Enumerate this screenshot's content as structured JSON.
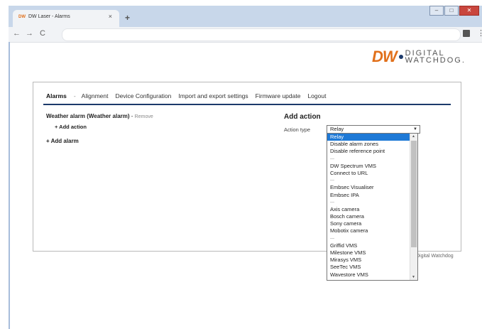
{
  "browser": {
    "tab_favicon": "DW",
    "tab_title": "DW Laser - Alarms",
    "tab_close": "×",
    "new_tab": "+",
    "nav_back": "←",
    "nav_forward": "→",
    "nav_reload": "C",
    "menu": "⋮",
    "window_controls": {
      "minimize": "–",
      "maximize": "□",
      "close": "✕"
    }
  },
  "logo": {
    "mark": "DW",
    "line1": "DIGITAL",
    "line2": "WATCHDOG."
  },
  "nav": {
    "tabs": [
      "Alarms",
      "Alignment",
      "Device Configuration",
      "Import and export settings",
      "Firmware update",
      "Logout"
    ],
    "separator": "-"
  },
  "alarm": {
    "title": "Weather alarm (Weather alarm)",
    "dash": "-",
    "remove": "Remove",
    "add_action": "+ Add action"
  },
  "add_alarm": "+ Add alarm",
  "add_action_panel": {
    "heading": "Add action",
    "type_label": "Action type",
    "selected": "Relay",
    "options": [
      "Relay",
      "Disable alarm zones",
      "Disable reference point",
      "---",
      "DW Spectrum VMS",
      "Connect to URL",
      "---",
      "Embsec Visualiser",
      "Embsec IPA",
      "---",
      "Axis camera",
      "Bosch camera",
      "Sony camera",
      "Mobotix camera",
      "---",
      "Griffid VMS",
      "Milestone VMS",
      "Mirasys VMS",
      "SeeTec VMS",
      "Wavestore VMS"
    ]
  },
  "credit": "Digital Watchdog",
  "colors": {
    "brand_orange": "#e1701b",
    "brand_navy": "#1c3a6b",
    "selection": "#1e79d6"
  }
}
